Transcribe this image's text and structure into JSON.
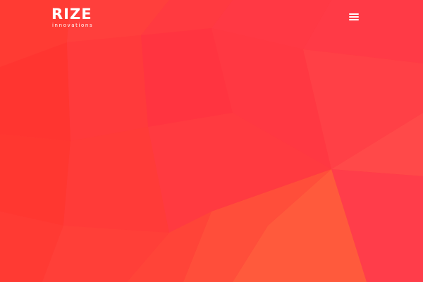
{
  "brand": {
    "name": "RIZE",
    "tagline": "innovations"
  },
  "header": {
    "menu_icon": "hamburger-menu-icon"
  },
  "colors": {
    "primary": "#ff3a3e",
    "accent_orange": "#ff5a3c",
    "text": "#ffffff"
  }
}
